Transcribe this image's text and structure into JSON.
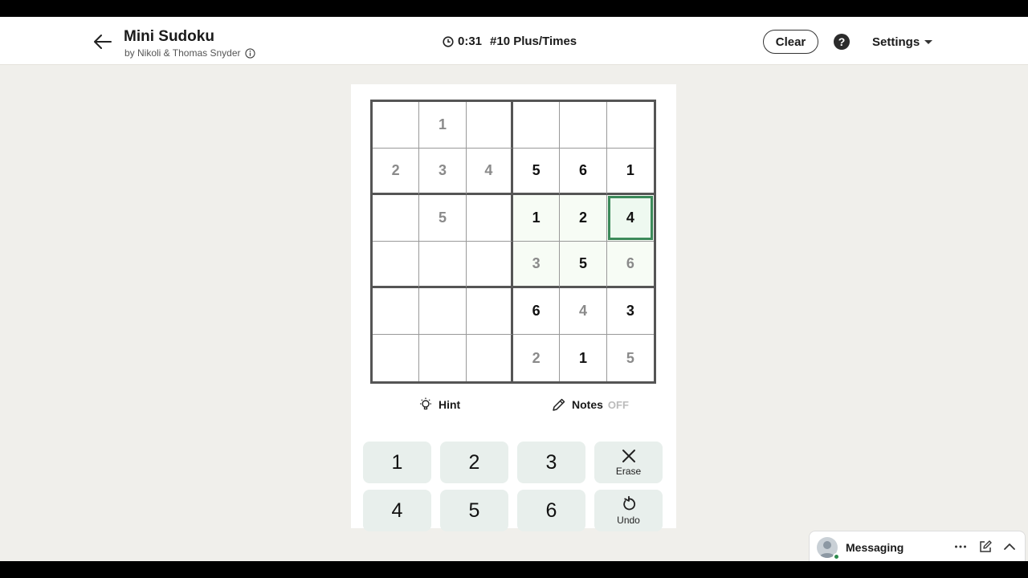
{
  "header": {
    "title": "Mini Sudoku",
    "byline": "by Nikoli & Thomas Snyder",
    "timer": "0:31",
    "puzzle_label": "#10 Plus/Times",
    "clear_label": "Clear",
    "help_label": "?",
    "settings_label": "Settings"
  },
  "grid": [
    [
      {
        "v": "",
        "g": false
      },
      {
        "v": "1",
        "g": false
      },
      {
        "v": "",
        "g": false
      },
      {
        "v": "",
        "g": false
      },
      {
        "v": "",
        "g": false
      },
      {
        "v": "",
        "g": false
      }
    ],
    [
      {
        "v": "2",
        "g": false
      },
      {
        "v": "3",
        "g": false
      },
      {
        "v": "4",
        "g": false
      },
      {
        "v": "5",
        "g": true
      },
      {
        "v": "6",
        "g": true
      },
      {
        "v": "1",
        "g": true
      }
    ],
    [
      {
        "v": "",
        "g": false
      },
      {
        "v": "5",
        "g": false
      },
      {
        "v": "",
        "g": false
      },
      {
        "v": "1",
        "g": true
      },
      {
        "v": "2",
        "g": true
      },
      {
        "v": "4",
        "g": true
      }
    ],
    [
      {
        "v": "",
        "g": false
      },
      {
        "v": "",
        "g": false
      },
      {
        "v": "",
        "g": false
      },
      {
        "v": "3",
        "g": false
      },
      {
        "v": "5",
        "g": true
      },
      {
        "v": "6",
        "g": false
      }
    ],
    [
      {
        "v": "",
        "g": false
      },
      {
        "v": "",
        "g": false
      },
      {
        "v": "",
        "g": false
      },
      {
        "v": "6",
        "g": true
      },
      {
        "v": "4",
        "g": false
      },
      {
        "v": "3",
        "g": true
      }
    ],
    [
      {
        "v": "",
        "g": false
      },
      {
        "v": "",
        "g": false
      },
      {
        "v": "",
        "g": false
      },
      {
        "v": "2",
        "g": false
      },
      {
        "v": "1",
        "g": true
      },
      {
        "v": "5",
        "g": false
      }
    ]
  ],
  "selected_cell": {
    "row": 3,
    "col": 6
  },
  "tools": {
    "hint_label": "Hint",
    "notes_label": "Notes",
    "notes_state": "OFF"
  },
  "keypad": {
    "keys": [
      "1",
      "2",
      "3",
      "4",
      "5",
      "6"
    ],
    "erase_label": "Erase",
    "undo_label": "Undo"
  },
  "messaging": {
    "label": "Messaging"
  },
  "colors": {
    "accent": "#3c8a5a",
    "key_bg": "#e8efec",
    "page_bg": "#f0efeb"
  }
}
